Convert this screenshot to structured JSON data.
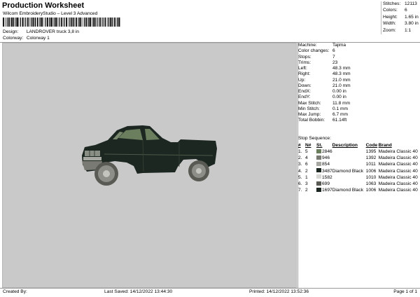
{
  "header": {
    "title": "Production Worksheet",
    "subtitle": "Wilcom EmbroideryStudio – Level 3 Advanced",
    "design_label": "Design:",
    "design_value": "LANDROVER truck 3,8 in",
    "colorway_label": "Colorway:",
    "colorway_value": "Colorway 1"
  },
  "stats": {
    "stitches_label": "Stitches:",
    "stitches_value": "12113",
    "colors_label": "Colors:",
    "colors_value": "6",
    "height_label": "Height:",
    "height_value": "1.65 in",
    "width_label": "Width:",
    "width_value": "3.80 in",
    "zoom_label": "Zoom:",
    "zoom_value": "1:1"
  },
  "info": {
    "machine_label": "Machine:",
    "machine_value": "Tajima",
    "color_changes_label": "Color changes:",
    "color_changes_value": "6",
    "stops_label": "Stops:",
    "stops_value": "7",
    "trims_label": "Trims:",
    "trims_value": "23",
    "left_label": "Left:",
    "left_value": "48.3 mm",
    "right_label": "Right:",
    "right_value": "48.3 mm",
    "up_label": "Up:",
    "up_value": "21.0 mm",
    "down_label": "Down:",
    "down_value": "21.0 mm",
    "endx_label": "EndX:",
    "endx_value": "0.00 in",
    "endy_label": "EndY:",
    "endy_value": "0.00 in",
    "max_stitch_label": "Max Stitch:",
    "max_stitch_value": "11.8 mm",
    "min_stitch_label": "Min Stitch:",
    "min_stitch_value": "0.1 mm",
    "max_jump_label": "Max Jump:",
    "max_jump_value": "6.7 mm",
    "total_bobbin_label": "Total Bobbin:",
    "total_bobbin_value": "61.14ft"
  },
  "stop_sequence": {
    "caption": "Stop Sequence:",
    "headers": [
      "#",
      "N#",
      "St.",
      "Description",
      "Code",
      "Brand"
    ],
    "rows": [
      {
        "num": "1.",
        "n": "5",
        "color": "#6b7f5f",
        "st": "2846",
        "desc": "",
        "code": "1395",
        "brand": "Madeira Classic 40"
      },
      {
        "num": "2.",
        "n": "4",
        "color": "#7a7a74",
        "st": "946",
        "desc": "",
        "code": "1392",
        "brand": "Madeira Classic 40"
      },
      {
        "num": "3.",
        "n": "6",
        "color": "#a8a8a2",
        "st": "854",
        "desc": "",
        "code": "1011",
        "brand": "Madeira Classic 40"
      },
      {
        "num": "4.",
        "n": "2",
        "color": "#1d2722",
        "st": "3487",
        "desc": "Diamond Black",
        "code": "1006",
        "brand": "Madeira Classic 40"
      },
      {
        "num": "5.",
        "n": "1",
        "color": "#d6d6d2",
        "st": "1582",
        "desc": "",
        "code": "1010",
        "brand": "Madeira Classic 40"
      },
      {
        "num": "6.",
        "n": "3",
        "color": "#5a5a54",
        "st": "699",
        "desc": "",
        "code": "1063",
        "brand": "Madeira Classic 40"
      },
      {
        "num": "7.",
        "n": "2",
        "color": "#1d2722",
        "st": "1697",
        "desc": "Diamond Black",
        "code": "1006",
        "brand": "Madeira Classic 40"
      }
    ]
  },
  "footer": {
    "created_by": "Created By:",
    "last_saved": "Last Saved: 14/12/2022 13:44:30",
    "printed": "Printed: 14/12/2022 13:52:36",
    "page": "Page 1 of 1"
  },
  "colors": {
    "canvas_bg": "#c9c9c9",
    "truck_body": "#1d2722",
    "truck_window": "#6b7f5f",
    "wheel": "#7a7a74"
  }
}
